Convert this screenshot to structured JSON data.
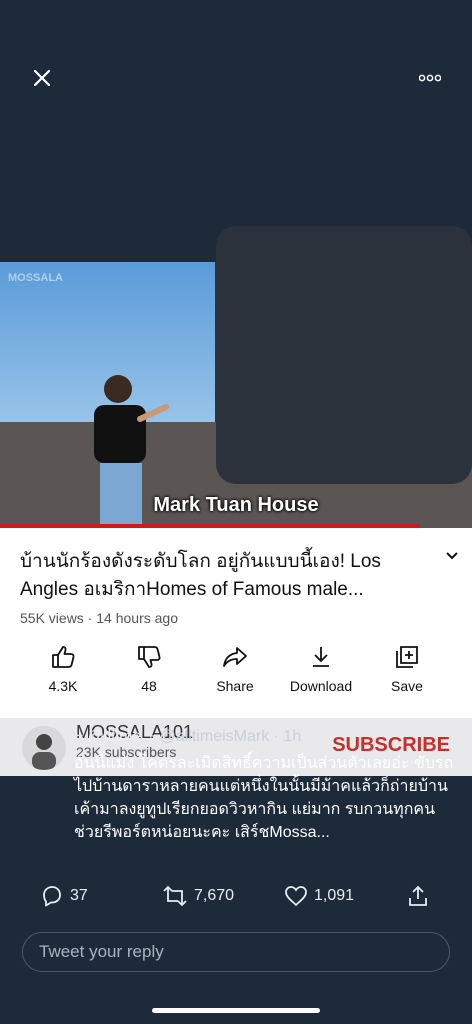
{
  "video": {
    "watermark": "MOSSALA",
    "caption": "Mark Tuan House",
    "progress": 0.89
  },
  "info": {
    "title": "บ้านนักร้องดังระดับโลก อยู่กันแบบนี้เอง! Los Angles อเมริกาHomes of Famous male...",
    "meta": "55K views · 14 hours ago",
    "actions": [
      {
        "label": "4.3K",
        "icon": "like-icon"
      },
      {
        "label": "48",
        "icon": "dislike-icon"
      },
      {
        "label": "Share",
        "icon": "share-icon"
      },
      {
        "label": "Download",
        "icon": "download-icon"
      },
      {
        "label": "Save",
        "icon": "save-icon"
      }
    ]
  },
  "channel": {
    "name": "MOSSALA101",
    "subs": "23K subscribers",
    "subscribe": "SUBSCRIBE"
  },
  "tweet": {
    "author": "~ @lltime ~",
    "handle": "@alltimeisMark",
    "time": "· 1h",
    "body": "อันนี้แม่ง โคตรละเมิดสิทธิ์ความเป็นส่วนตัวเลยอ่ะ ขับรถไปบ้านดาราหลายคนแต่หนึ่งในนั้นมีม้าคแล้วก็ถ่ายบ้านเค้ามาลงยูทูปเรียกยอดวิวหากิน แย่มาก รบกวนทุกคนช่วยรีพอร์ตหน่อยนะคะ เสิร์ชMossa...",
    "replies": "37",
    "retweets": "7,670",
    "likes": "1,091"
  },
  "reply": {
    "placeholder": "Tweet your reply"
  }
}
